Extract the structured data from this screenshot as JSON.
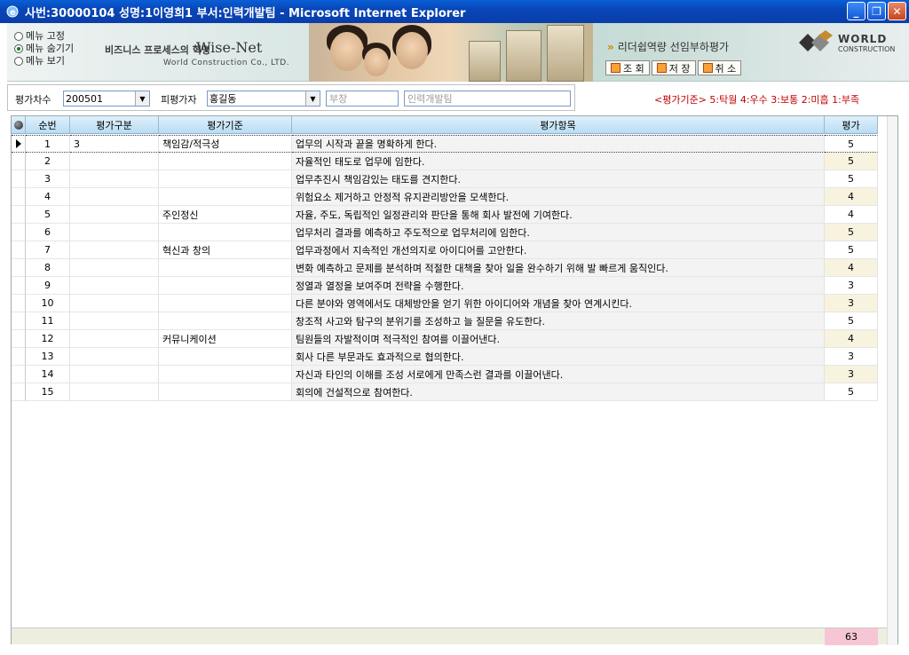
{
  "window": {
    "title": "사번:30000104 성명:1이영희1 부서:인력개발팀 - Microsoft Internet Explorer"
  },
  "menu_options": [
    {
      "label": "메뉴 고정",
      "selected": false
    },
    {
      "label": "메뉴 숨기기",
      "selected": true
    },
    {
      "label": "메뉴 보기",
      "selected": false
    }
  ],
  "brand": {
    "slogan": "비즈니스 프로세스의 혁명",
    "name": "Wise-Net",
    "company": "World Construction Co., LTD."
  },
  "banner_title": "리더쉽역량 선임부하평가",
  "toolbar": {
    "query_label": "조 회",
    "save_label": "저 장",
    "cancel_label": "취 소"
  },
  "logo": {
    "line1": "WORLD",
    "line2": "CONSTRUCTION"
  },
  "filters": {
    "period_label": "평가차수",
    "period_value": "200501",
    "evaluatee_label": "피평가자",
    "evaluatee_value": "홍길동",
    "position_value": "부장",
    "dept_value": "인력개발팀"
  },
  "criteria_text": "<평가기준> 5:탁월 4:우수 3:보통 2:미흡 1:부족",
  "grid": {
    "headers": [
      "순번",
      "평가구분",
      "평가기준",
      "평가항목",
      "평가"
    ],
    "rows": [
      {
        "no": "1",
        "category": "3",
        "criterion": "책임감/적극성",
        "item": "업무의 시작과 끝을 명확하게 한다.",
        "score": "5",
        "alt": false
      },
      {
        "no": "2",
        "category": "",
        "criterion": "",
        "item": "자율적인 태도로 업무에 임한다.",
        "score": "5",
        "alt": true
      },
      {
        "no": "3",
        "category": "",
        "criterion": "",
        "item": "업무추진시 책임감있는 태도를 견지한다.",
        "score": "5",
        "alt": false
      },
      {
        "no": "4",
        "category": "",
        "criterion": "",
        "item": "위험요소 제거하고 안정적 유지관리방안을 모색한다.",
        "score": "4",
        "alt": true
      },
      {
        "no": "5",
        "category": "",
        "criterion": "주인정신",
        "item": "자율, 주도, 독립적인 일정관리와 판단을 통해 회사 발전에 기여한다.",
        "score": "4",
        "alt": false
      },
      {
        "no": "6",
        "category": "",
        "criterion": "",
        "item": "업무처리 결과를 예측하고 주도적으로 업무처리에 임한다.",
        "score": "5",
        "alt": true
      },
      {
        "no": "7",
        "category": "",
        "criterion": "혁신과 창의",
        "item": "업무과정에서 지속적인 개선의지로 아이디어를 고안한다.",
        "score": "5",
        "alt": false
      },
      {
        "no": "8",
        "category": "",
        "criterion": "",
        "item": "변화 예측하고 문제를 분석하며 적절한 대책을 찾아 일을 완수하기 위해 발 빠르게 움직인다.",
        "score": "4",
        "alt": true
      },
      {
        "no": "9",
        "category": "",
        "criterion": "",
        "item": "정열과 열정을 보여주며 전략을 수행한다.",
        "score": "3",
        "alt": false
      },
      {
        "no": "10",
        "category": "",
        "criterion": "",
        "item": "다른 분야와 영역에서도 대체방안을 얻기 위한 아이디어와 개념을 찾아 연계시킨다.",
        "score": "3",
        "alt": true
      },
      {
        "no": "11",
        "category": "",
        "criterion": "",
        "item": "창조적 사고와 탐구의 분위기를 조성하고 늘 질문을 유도한다.",
        "score": "5",
        "alt": false
      },
      {
        "no": "12",
        "category": "",
        "criterion": "커뮤니케이션",
        "item": "팀원들의 자발적이며 적극적인 참여를 이끌어낸다.",
        "score": "4",
        "alt": true
      },
      {
        "no": "13",
        "category": "",
        "criterion": "",
        "item": "회사 다른 부문과도 효과적으로 협의한다.",
        "score": "3",
        "alt": false
      },
      {
        "no": "14",
        "category": "",
        "criterion": "",
        "item": "자신과 타인의 이해를 조성 서로에게 만족스런 결과를 이끌어낸다.",
        "score": "3",
        "alt": true
      },
      {
        "no": "15",
        "category": "",
        "criterion": "",
        "item": "회의에 건설적으로 참여한다.",
        "score": "5",
        "alt": false
      }
    ],
    "total": "63"
  }
}
